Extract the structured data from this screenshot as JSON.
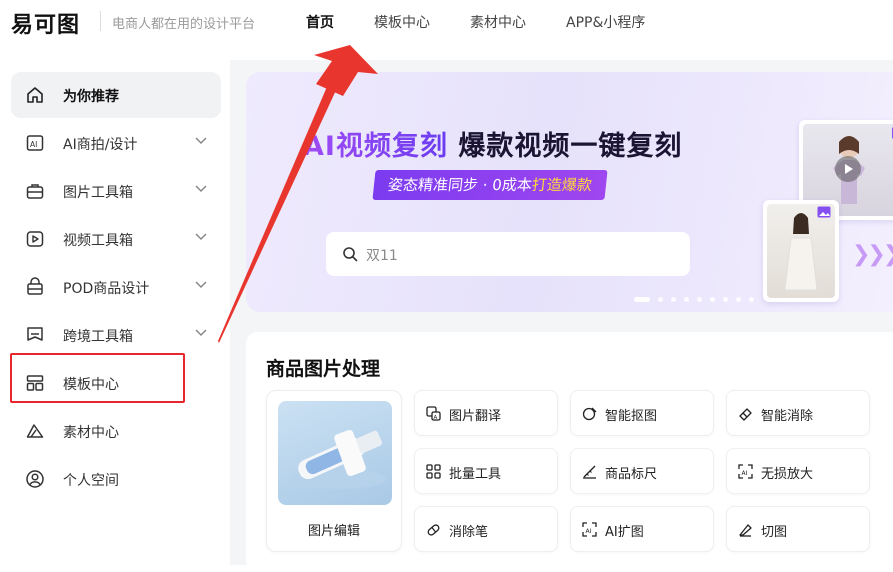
{
  "header": {
    "logo": "易可图",
    "tagline": "电商人都在用的设计平台",
    "nav": [
      "首页",
      "模板中心",
      "素材中心",
      "APP&小程序"
    ],
    "active_nav": "首页"
  },
  "sidebar": {
    "items": [
      {
        "label": "为你推荐",
        "icon": "home-icon",
        "active": true
      },
      {
        "label": "AI商拍/设计",
        "icon": "ai-icon",
        "expandable": true
      },
      {
        "label": "图片工具箱",
        "icon": "toolbox-icon",
        "expandable": true
      },
      {
        "label": "视频工具箱",
        "icon": "video-icon",
        "expandable": true
      },
      {
        "label": "POD商品设计",
        "icon": "bag-icon",
        "expandable": true
      },
      {
        "label": "跨境工具箱",
        "icon": "crossborder-icon",
        "expandable": true
      },
      {
        "label": "模板中心",
        "icon": "template-icon",
        "highlighted": true
      },
      {
        "label": "素材中心",
        "icon": "material-icon"
      },
      {
        "label": "个人空间",
        "icon": "user-icon"
      }
    ]
  },
  "banner": {
    "title_gradient": "AI视频复刻",
    "title_rest": "爆款视频一键复刻",
    "subtitle_pre": "姿态精准同步 · 0成本",
    "subtitle_hl": "打造爆款",
    "search_placeholder": "双11",
    "carousel_count": 9,
    "carousel_active": 1
  },
  "section": {
    "title": "商品图片处理",
    "feature": {
      "label": "图片编辑"
    },
    "tools": [
      {
        "label": "图片翻译",
        "icon": "translate-icon"
      },
      {
        "label": "智能抠图",
        "icon": "cutout-icon"
      },
      {
        "label": "智能消除",
        "icon": "erase-icon"
      },
      {
        "label": "批量工具",
        "icon": "grid-icon"
      },
      {
        "label": "商品标尺",
        "icon": "ruler-icon"
      },
      {
        "label": "无损放大",
        "icon": "upscale-icon"
      },
      {
        "label": "消除笔",
        "icon": "eraser-pen-icon"
      },
      {
        "label": "AI扩图",
        "icon": "expand-icon"
      },
      {
        "label": "切图",
        "icon": "slice-icon"
      }
    ]
  },
  "colors": {
    "accent": "#7c3bf0",
    "highlight_box": "#e8262e",
    "arrow": "#e8362e",
    "main_bg": "#f4f5f7"
  }
}
